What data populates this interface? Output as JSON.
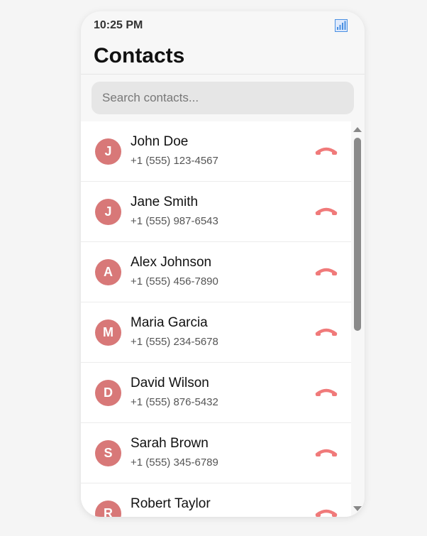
{
  "status_bar": {
    "time": "10:25 PM",
    "signal_icon": "signal-icon"
  },
  "header": {
    "title": "Contacts"
  },
  "search": {
    "placeholder": "Search contacts...",
    "value": ""
  },
  "colors": {
    "avatar_bg": "#d87878",
    "call_icon": "#f07a7a",
    "signal_icon": "#4a90e2"
  },
  "contacts": [
    {
      "initial": "J",
      "name": "John Doe",
      "phone": "+1 (555) 123-4567",
      "icon": "call-icon"
    },
    {
      "initial": "J",
      "name": "Jane Smith",
      "phone": "+1 (555) 987-6543",
      "icon": "call-icon"
    },
    {
      "initial": "A",
      "name": "Alex Johnson",
      "phone": "+1 (555) 456-7890",
      "icon": "call-icon"
    },
    {
      "initial": "M",
      "name": "Maria Garcia",
      "phone": "+1 (555) 234-5678",
      "icon": "call-icon"
    },
    {
      "initial": "D",
      "name": "David Wilson",
      "phone": "+1 (555) 876-5432",
      "icon": "call-icon"
    },
    {
      "initial": "S",
      "name": "Sarah Brown",
      "phone": "+1 (555) 345-6789",
      "icon": "call-icon"
    },
    {
      "initial": "R",
      "name": "Robert Taylor",
      "phone": "",
      "icon": "call-icon"
    }
  ]
}
